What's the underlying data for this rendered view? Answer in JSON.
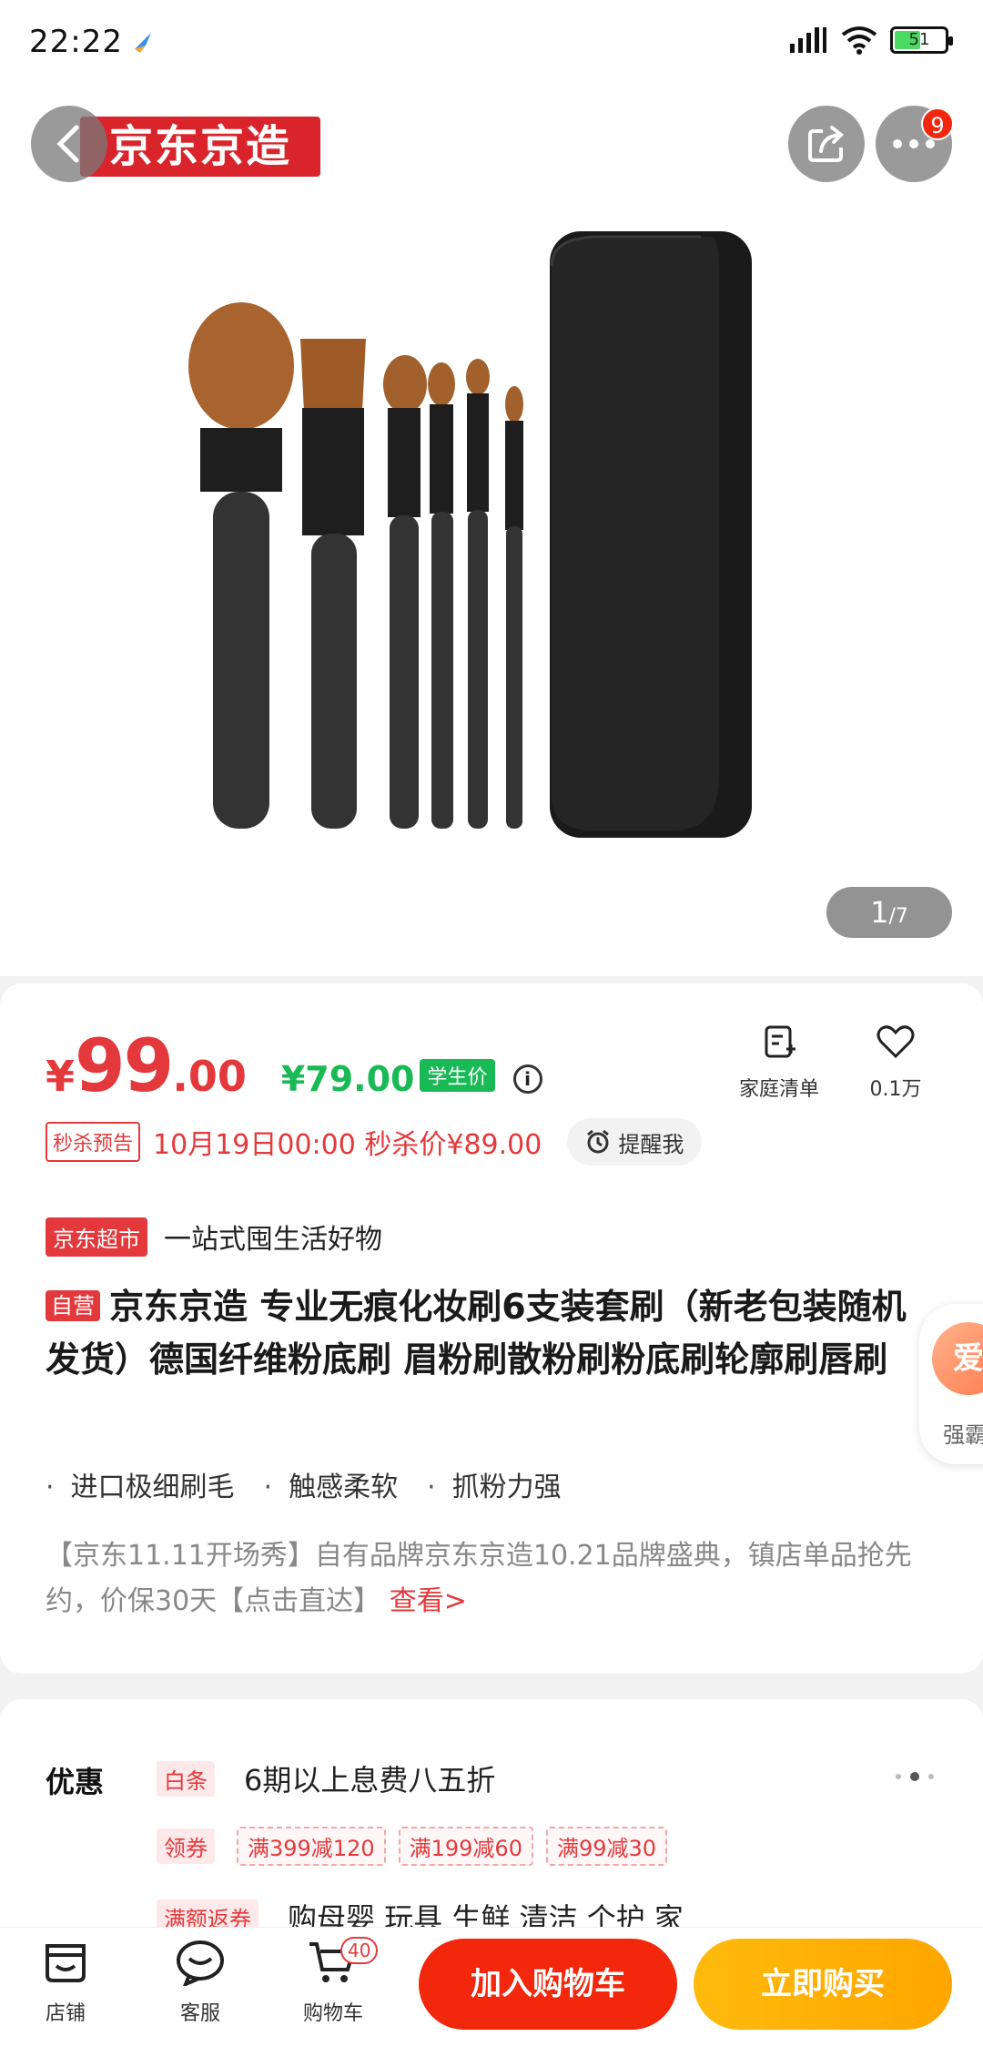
{
  "status_bar": {
    "time": "22:22",
    "battery": "51"
  },
  "header": {
    "brand": "京东京造",
    "more_badge": "9"
  },
  "gallery": {
    "current": "1",
    "total": "/7"
  },
  "price": {
    "symbol": "¥",
    "integer": "99",
    "decimal": ".00",
    "student_price": "¥79.00",
    "student_tag": "学生价"
  },
  "actions": {
    "family_list": "家庭清单",
    "favorites": "0.1万"
  },
  "seckill": {
    "tag": "秒杀预告",
    "text": "10月19日00:00 秒杀价¥89.00",
    "remind": "提醒我"
  },
  "market": {
    "tag": "京东超市",
    "slogan": "一站式囤生活好物"
  },
  "product": {
    "self_tag": "自营",
    "title": "京东京造 专业无痕化妆刷6支装套刷（新老包装随机发货）德国纤维粉底刷 眉粉刷散粉刷粉底刷轮廓刷唇刷",
    "features": [
      "进口极细刷毛",
      "触感柔软",
      "抓粉力强"
    ],
    "promo_text": "【京东11.11开场秀】自有品牌京东京造10.21品牌盛典，镇店单品抢先约，价保30天【点击直达】",
    "promo_link": "查看>"
  },
  "float_helper": {
    "ball": "爱",
    "text": "强霸"
  },
  "discount": {
    "label": "优惠",
    "baitiao_tag": "白条",
    "baitiao_text": "6期以上息费八五折",
    "coupon_tag": "领券",
    "coupons": [
      "满399减120",
      "满199减60",
      "满99减30"
    ],
    "rebate_tag": "满额返券",
    "rebate_text": "购母婴 玩具 生鲜 清洁 个护 家"
  },
  "bottom_bar": {
    "store": "店铺",
    "service": "客服",
    "cart": "购物车",
    "cart_count": "40",
    "add_to_cart": "加入购物车",
    "buy_now": "立即购买"
  },
  "colors": {
    "jd_red": "#e4393c",
    "student_green": "#19b955",
    "buy_orange": "#ffa600"
  }
}
